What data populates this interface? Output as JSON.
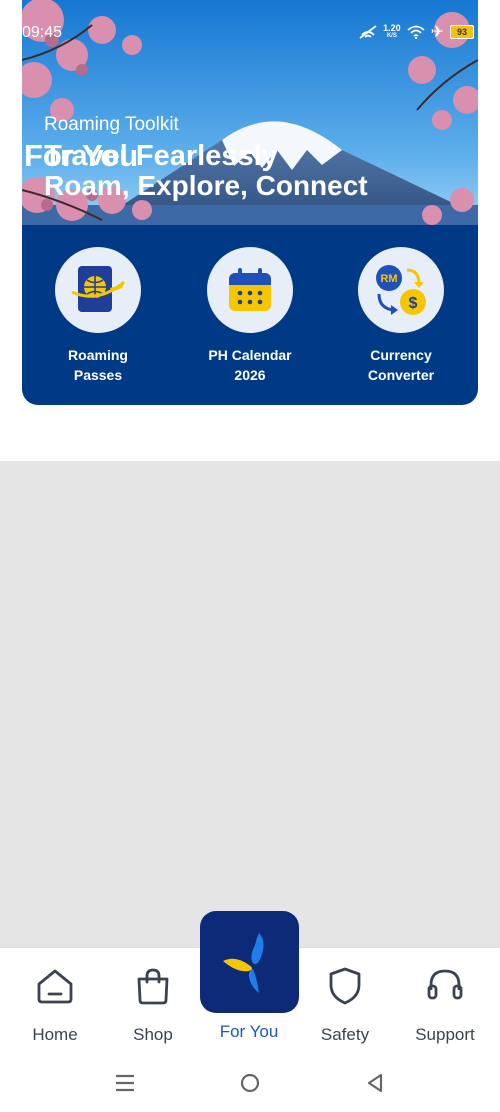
{
  "status_bar": {
    "time": "09:45",
    "speed_value": "1.20",
    "speed_unit": "K/S",
    "battery": "93"
  },
  "hero": {
    "kicker": "Roaming Toolkit",
    "headline_line1": "Travel Fearlessly",
    "overlay_title": "For You",
    "headline_line2": "Roam, Explore, Connect"
  },
  "tools": [
    {
      "label": "Roaming\nPasses",
      "icon": "passport-plane-icon"
    },
    {
      "label": "PH Calendar\n2026",
      "icon": "calendar-icon"
    },
    {
      "label": "Currency\nConverter",
      "icon": "currency-exchange-icon",
      "icon_text_top": "RM",
      "icon_text_bottom": "$"
    }
  ],
  "bottom_nav": {
    "items": [
      {
        "label": "Home",
        "icon": "home-icon"
      },
      {
        "label": "Shop",
        "icon": "shopping-bag-icon"
      },
      {
        "label": "For You",
        "icon": "brand-logo-icon",
        "active": true
      },
      {
        "label": "Safety",
        "icon": "shield-icon"
      },
      {
        "label": "Support",
        "icon": "headset-icon"
      }
    ]
  },
  "colors": {
    "card_blue": "#003a87",
    "active_nav": "#1a56c9",
    "fab_bg": "#0c2a78",
    "accent_yellow": "#f6c700",
    "gray_body": "#e5e5e5"
  }
}
